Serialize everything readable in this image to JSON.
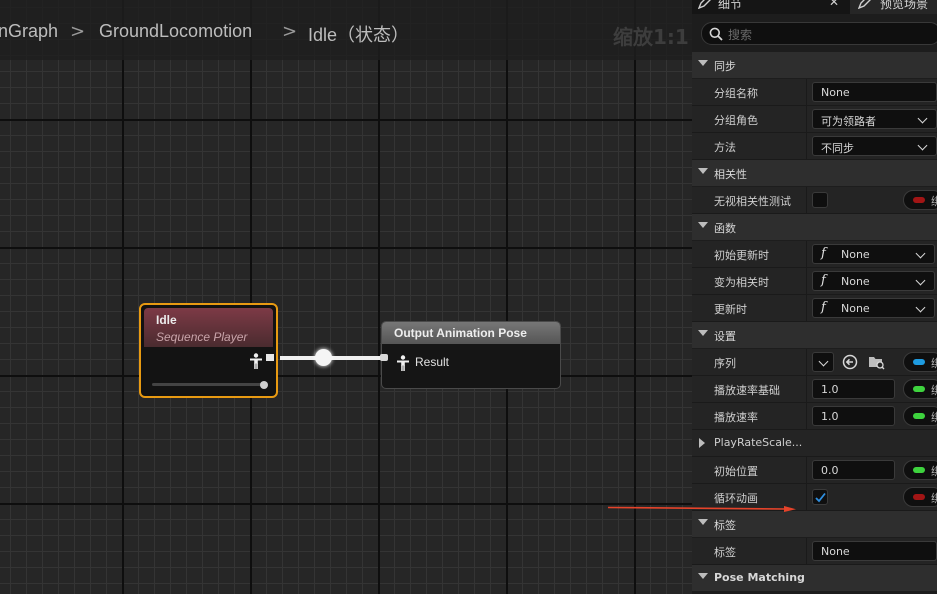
{
  "breadcrumb": {
    "items": [
      "nGraph",
      "GroundLocomotion",
      "Idle（状态）"
    ],
    "separator": ">",
    "zoom": "缩放1:1"
  },
  "graph": {
    "idle_node": {
      "title": "Idle",
      "subtitle": "Sequence Player"
    },
    "output_node": {
      "title": "Output Animation Pose",
      "pin_label": "Result"
    }
  },
  "details": {
    "tabs": [
      "细节",
      "预览场景"
    ],
    "search_placeholder": "搜索",
    "sections": {
      "sync": {
        "title": "同步",
        "group_name": {
          "label": "分组名称",
          "value": "None"
        },
        "group_role": {
          "label": "分组角色",
          "value": "可为领路者"
        },
        "method": {
          "label": "方法",
          "value": "不同步"
        }
      },
      "relevancy": {
        "title": "相关性",
        "ignore_test": {
          "label": "无视相关性测试",
          "pin_text": "绑"
        }
      },
      "functions": {
        "title": "函数",
        "on_initial_update": {
          "label": "初始更新时",
          "value": "None"
        },
        "on_become_relevant": {
          "label": "变为相关时",
          "value": "None"
        },
        "on_update": {
          "label": "更新时",
          "value": "None"
        }
      },
      "settings": {
        "title": "设置",
        "sequence": {
          "label": "序列",
          "pin_text": "绑"
        },
        "play_rate_basis": {
          "label": "播放速率基础",
          "value": "1.0",
          "pin_text": "绑"
        },
        "play_rate": {
          "label": "播放速率",
          "value": "1.0",
          "pin_text": "绑"
        },
        "play_rate_scale": {
          "label": "PlayRateScale..."
        },
        "start_position": {
          "label": "初始位置",
          "value": "0.0",
          "pin_text": "绑"
        },
        "loop_animation": {
          "label": "循环动画",
          "checked": true,
          "pin_text": "绑"
        }
      },
      "tags": {
        "title": "标签",
        "tag": {
          "label": "标签",
          "value": "None"
        }
      },
      "pose_matching": {
        "title": "Pose Matching"
      }
    }
  },
  "colors": {
    "node_selected": "#e89a12",
    "pin_blue": "#1e9be0",
    "pin_green": "#3ed33e",
    "pin_red": "#a21515",
    "annotation_arrow": "#e5432a"
  }
}
